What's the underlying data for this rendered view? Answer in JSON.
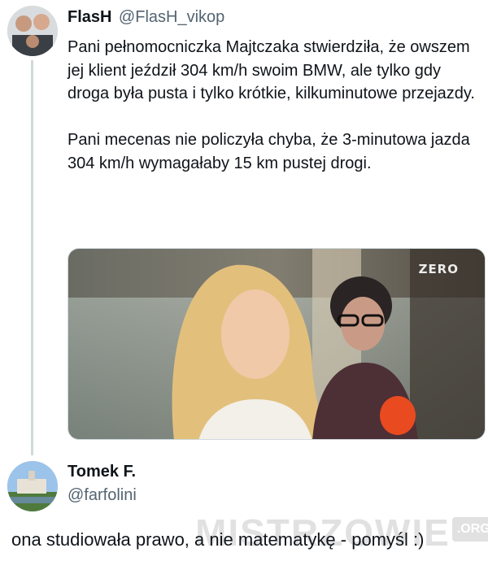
{
  "tweet1": {
    "name": "FlasH",
    "handle": "@FlasH_vikop",
    "text": "Pani pełnomocniczka Majtczaka stwierdziła, że owszem jej klient jeździł 304 km/h swoim BMW, ale tylko gdy droga była pusta i tylko krótkie, kilkuminutowe przejazdy.\n\nPani mecenas nie policzyła chyba, że 3-minutowa jazda 304 km/h wymagałaby 15 km pustej drogi.",
    "media_logo": "ZERO"
  },
  "tweet2": {
    "name": "Tomek F.",
    "handle": "@farfolini",
    "text": "ona studiowała prawo, a nie matematykę - pomyśl :)"
  },
  "watermark": {
    "text": "MISTRZOWIE",
    "suffix": ".ORG"
  },
  "colors": {
    "text": "#0f1419",
    "secondary": "#536471",
    "thread_line": "#cfd9de"
  }
}
